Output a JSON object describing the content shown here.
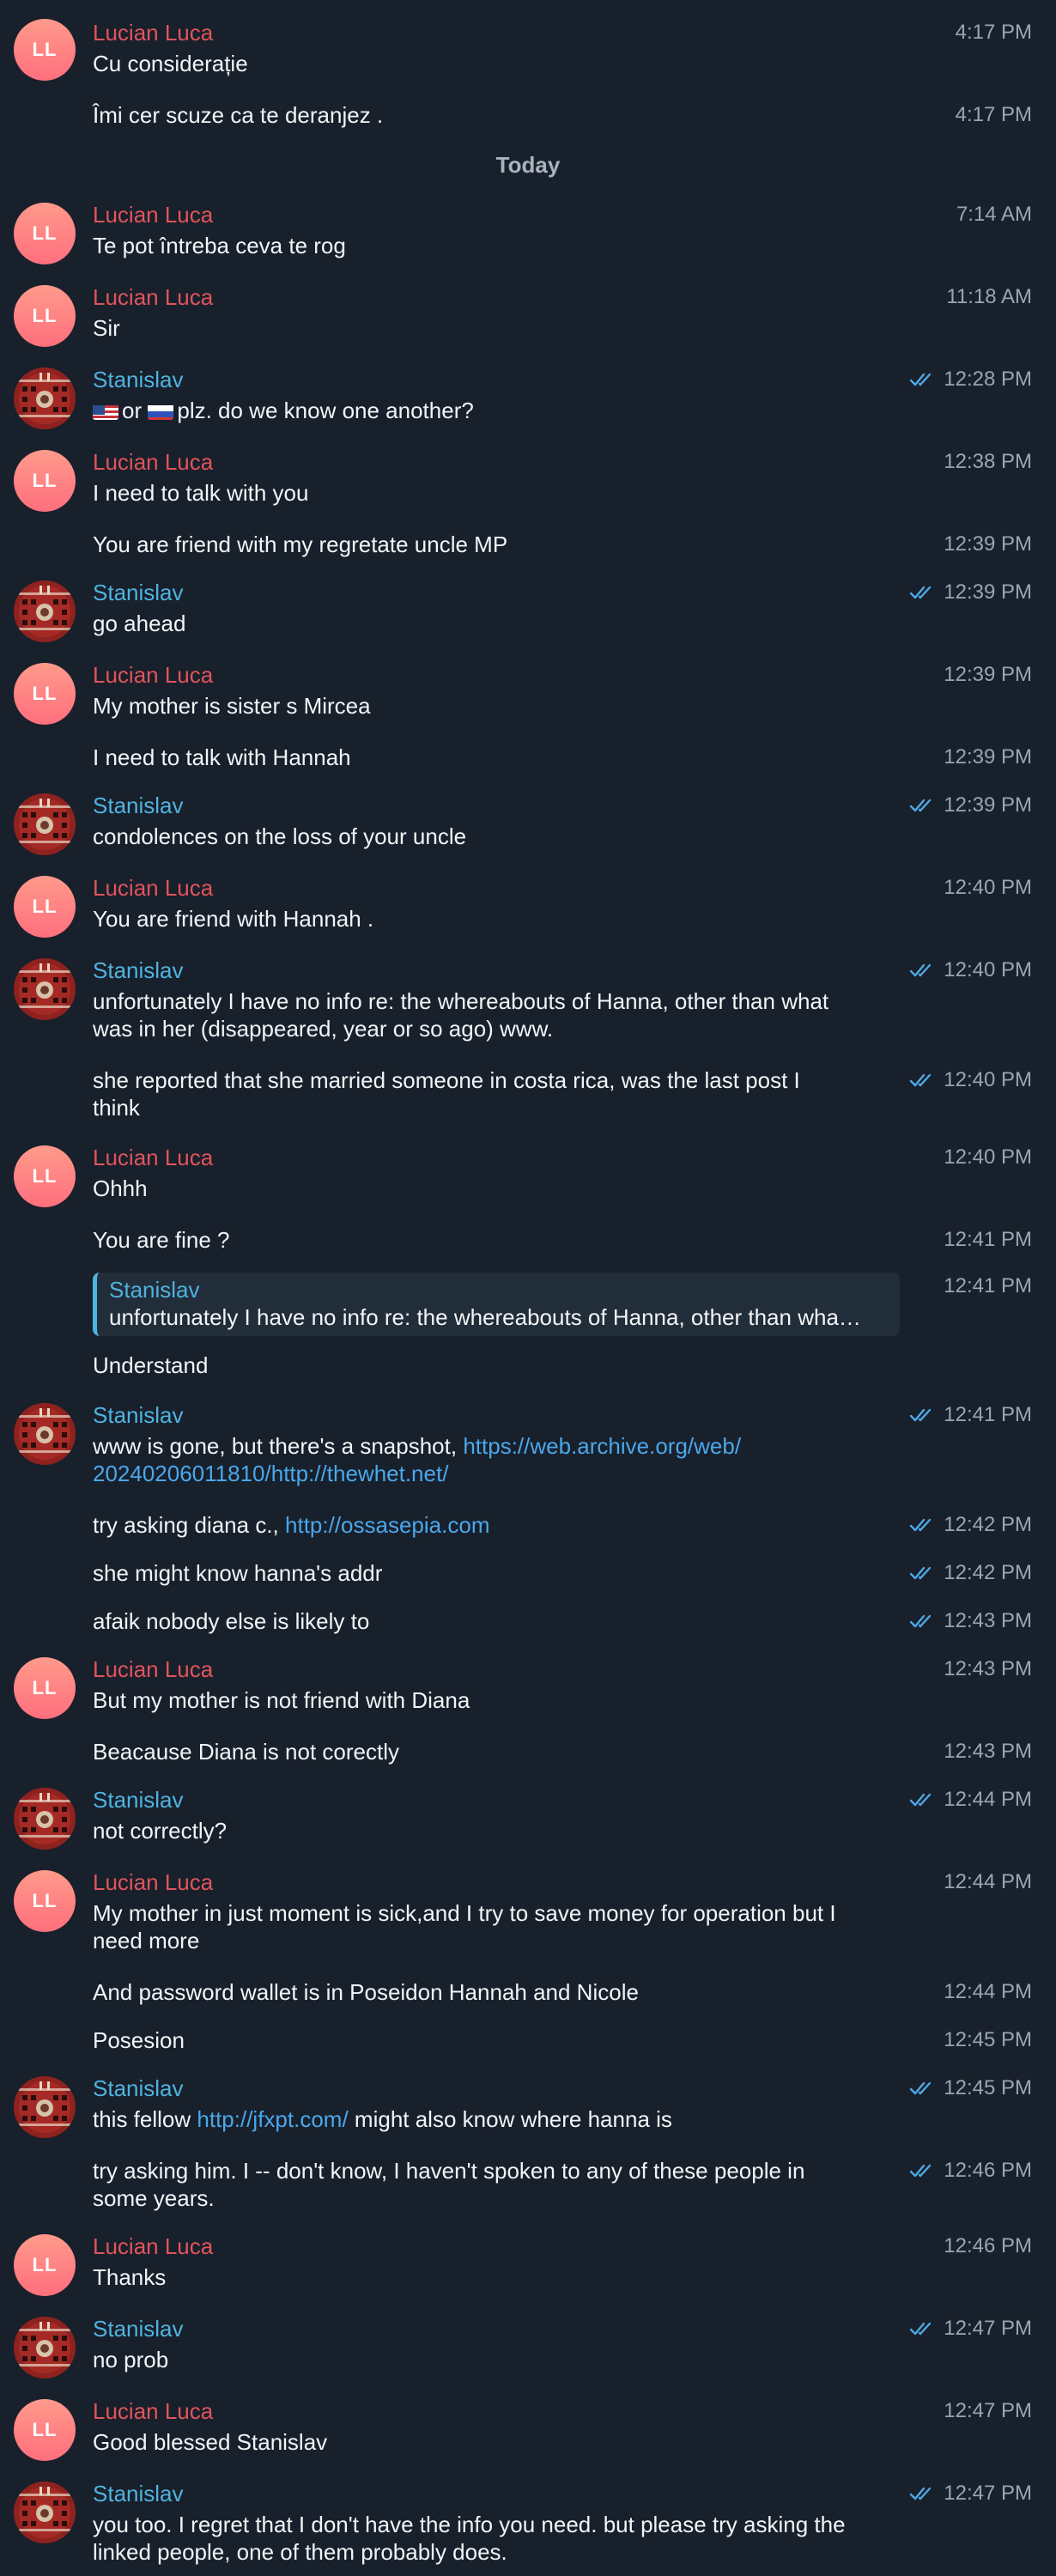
{
  "users": {
    "lucian": {
      "name": "Lucian Luca",
      "initials": "LL",
      "color": "#e1545c"
    },
    "stanislav": {
      "name": "Stanislav",
      "color": "#4fb3e0"
    }
  },
  "day_separator": "Today",
  "messages": [
    {
      "id": "m1",
      "time": "4:17 PM",
      "text": "Cu considerație"
    },
    {
      "id": "m2",
      "time": "4:17 PM",
      "text": "Îmi cer scuze ca te deranjez ."
    },
    {
      "id": "m3",
      "time": "7:14 AM",
      "text": "Te pot întreba ceva te rog"
    },
    {
      "id": "m4",
      "time": "11:18 AM",
      "text": "Sir"
    },
    {
      "id": "m5",
      "time": "12:28 PM",
      "text_a": "or",
      "text_b": "plz. do we know one another?"
    },
    {
      "id": "m6",
      "time": "12:38 PM",
      "text": "I need to talk with you"
    },
    {
      "id": "m7",
      "time": "12:39 PM",
      "text": "You are friend with my regretate uncle MP"
    },
    {
      "id": "m8",
      "time": "12:39 PM",
      "text": "go ahead"
    },
    {
      "id": "m9",
      "time": "12:39 PM",
      "text": "My mother is sister s Mircea"
    },
    {
      "id": "m10",
      "time": "12:39 PM",
      "text": "I need to talk with Hannah"
    },
    {
      "id": "m11",
      "time": "12:39 PM",
      "text": "condolences on the loss of your uncle"
    },
    {
      "id": "m12",
      "time": "12:40 PM",
      "text": "You are friend with Hannah ."
    },
    {
      "id": "m13",
      "time": "12:40 PM",
      "line1": "unfortunately I have no info re: the whereabouts of Hanna, other than what",
      "line2": "was in her (disappeared, year or so ago) www."
    },
    {
      "id": "m14",
      "time": "12:40 PM",
      "line1": "she reported that she married someone in costa rica, was the last post I",
      "line2": "think"
    },
    {
      "id": "m15",
      "time": "12:40 PM",
      "text": "Ohhh"
    },
    {
      "id": "m16",
      "time": "12:41 PM",
      "text": "You are fine ?"
    },
    {
      "id": "m17",
      "time": "12:41 PM",
      "reply_name": "Stanislav",
      "reply_text": "unfortunately I have no info re: the whereabouts of Hanna, other than wha…"
    },
    {
      "id": "m18",
      "text": "Understand"
    },
    {
      "id": "m19",
      "time": "12:41 PM",
      "text": "www is gone, but there's a snapshot,",
      "link1": "https://web.archive.org/web/",
      "link2": "20240206011810/http://thewhet.net/"
    },
    {
      "id": "m20",
      "time": "12:42 PM",
      "text": "try asking diana c.,",
      "link": "http://ossasepia.com"
    },
    {
      "id": "m21",
      "time": "12:42 PM",
      "text": "she might know hanna's addr"
    },
    {
      "id": "m22",
      "time": "12:43 PM",
      "text": "afaik nobody else is likely to"
    },
    {
      "id": "m23",
      "time": "12:43 PM",
      "text": "But my mother is not friend with Diana"
    },
    {
      "id": "m24",
      "time": "12:43 PM",
      "text": "Beacause Diana is not corectly"
    },
    {
      "id": "m25",
      "time": "12:44 PM",
      "text": "not correctly?"
    },
    {
      "id": "m26",
      "time": "12:44 PM",
      "line1": "My mother in just moment is sick,and I try to save money for operation but I",
      "line2": "need more"
    },
    {
      "id": "m27",
      "time": "12:44 PM",
      "text": "And password wallet is in Poseidon Hannah and Nicole"
    },
    {
      "id": "m28",
      "time": "12:45 PM",
      "text": "Posesion"
    },
    {
      "id": "m29",
      "time": "12:45 PM",
      "text_a": "this fellow",
      "link": "http://jfxpt.com/",
      "text_b": "might also know where hanna is"
    },
    {
      "id": "m30",
      "time": "12:46 PM",
      "line1": "try asking him. I -- don't know, I haven't spoken to any of these people in",
      "line2": "some years."
    },
    {
      "id": "m31",
      "time": "12:46 PM",
      "text": "Thanks"
    },
    {
      "id": "m32",
      "time": "12:47 PM",
      "text": "no prob"
    },
    {
      "id": "m33",
      "time": "12:47 PM",
      "text": "Good blessed Stanislav"
    },
    {
      "id": "m34",
      "time": "12:47 PM",
      "line1": "you too. I regret that I don't have the info you need. but please try asking the",
      "line2": "linked people, one of them probably does."
    }
  ]
}
